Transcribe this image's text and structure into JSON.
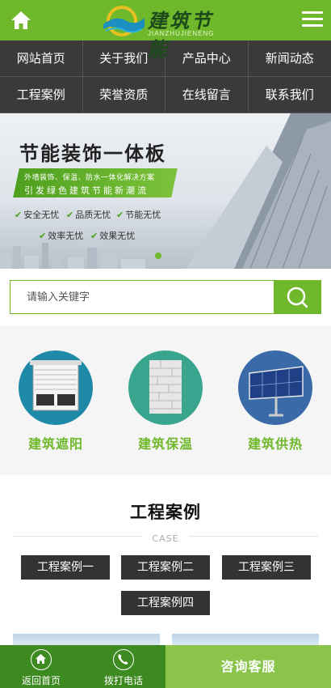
{
  "header": {
    "logo_text": "建筑节能",
    "logo_sub": "JIANZHUJIENENG"
  },
  "nav": [
    {
      "label": "网站首页"
    },
    {
      "label": "关于我们"
    },
    {
      "label": "产品中心"
    },
    {
      "label": "新闻动态"
    },
    {
      "label": "工程案例"
    },
    {
      "label": "荣誉资质"
    },
    {
      "label": "在线留言"
    },
    {
      "label": "联系我们"
    }
  ],
  "banner": {
    "title": "节能装饰一体板",
    "line1": "外墙装饰、保温、防水一体化解决方案",
    "line2": "引发绿色建筑节能新潮流",
    "features": [
      "安全无忧",
      "品质无忧",
      "节能无忧",
      "效率无忧",
      "效果无忧"
    ]
  },
  "search": {
    "placeholder": "请输入关键字"
  },
  "categories": [
    {
      "label": "建筑遮阳",
      "color": "#1f8aa8"
    },
    {
      "label": "建筑保温",
      "color": "#3aa58f"
    },
    {
      "label": "建筑供热",
      "color": "#3a6aa8"
    }
  ],
  "cases": {
    "title": "工程案例",
    "subtitle": "CASE",
    "tags": [
      "工程案例一",
      "工程案例二",
      "工程案例三",
      "工程案例四"
    ]
  },
  "bottom": {
    "home": "返回首页",
    "phone": "拨打电话",
    "cta": "咨询客服"
  },
  "colors": {
    "accent": "#6fb82b",
    "nav_bg": "#3a3a3a",
    "bottom_bg": "#3d8b20",
    "cta_bg": "#8bc44a"
  }
}
